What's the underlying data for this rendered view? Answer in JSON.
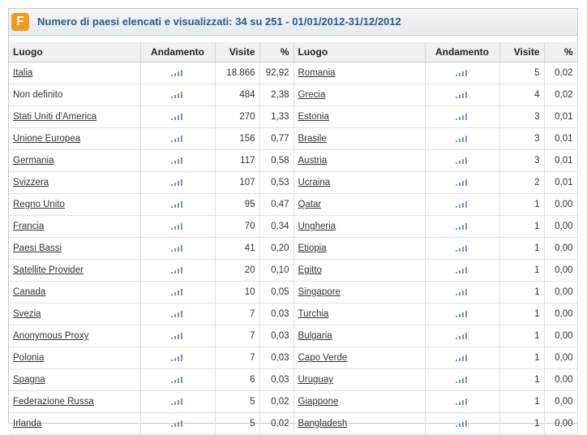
{
  "header": {
    "title": "Numero di paesi elencati e visualizzati: 34 su 251 - 01/01/2012-31/12/2012",
    "logo_letter": "F"
  },
  "columns": {
    "luogo": "Luogo",
    "andamento": "Andamento",
    "visite": "Visite",
    "pct": "%"
  },
  "left": [
    {
      "name": "Italia",
      "visits": "18.866",
      "pct": "92,92",
      "link": true
    },
    {
      "name": "Non definito",
      "visits": "484",
      "pct": "2,38",
      "link": false
    },
    {
      "name": "Stati Uniti d'America",
      "visits": "270",
      "pct": "1,33",
      "link": true
    },
    {
      "name": "Unione Europea",
      "visits": "156",
      "pct": "0,77",
      "link": true
    },
    {
      "name": "Germania",
      "visits": "117",
      "pct": "0,58",
      "link": true
    },
    {
      "name": "Svizzera",
      "visits": "107",
      "pct": "0,53",
      "link": true
    },
    {
      "name": "Regno Unito",
      "visits": "95",
      "pct": "0,47",
      "link": true
    },
    {
      "name": "Francia",
      "visits": "70",
      "pct": "0,34",
      "link": true
    },
    {
      "name": "Paesi Bassi",
      "visits": "41",
      "pct": "0,20",
      "link": true
    },
    {
      "name": "Satellite Provider",
      "visits": "20",
      "pct": "0,10",
      "link": true
    },
    {
      "name": "Canada",
      "visits": "10",
      "pct": "0,05",
      "link": true
    },
    {
      "name": "Svezia",
      "visits": "7",
      "pct": "0,03",
      "link": true
    },
    {
      "name": "Anonymous Proxy",
      "visits": "7",
      "pct": "0,03",
      "link": true
    },
    {
      "name": "Polonia",
      "visits": "7",
      "pct": "0,03",
      "link": true
    },
    {
      "name": "Spagna",
      "visits": "6",
      "pct": "0,03",
      "link": true
    },
    {
      "name": "Federazione Russa",
      "visits": "5",
      "pct": "0,02",
      "link": true
    },
    {
      "name": "Irlanda",
      "visits": "5",
      "pct": "0,02",
      "link": true
    }
  ],
  "right": [
    {
      "name": "Romania",
      "visits": "5",
      "pct": "0,02",
      "link": true
    },
    {
      "name": "Grecia",
      "visits": "4",
      "pct": "0,02",
      "link": true
    },
    {
      "name": "Estonia",
      "visits": "3",
      "pct": "0,01",
      "link": true
    },
    {
      "name": "Brasile",
      "visits": "3",
      "pct": "0,01",
      "link": true
    },
    {
      "name": "Austria",
      "visits": "3",
      "pct": "0,01",
      "link": true
    },
    {
      "name": "Ucraina",
      "visits": "2",
      "pct": "0,01",
      "link": true
    },
    {
      "name": "Qatar",
      "visits": "1",
      "pct": "0,00",
      "link": true
    },
    {
      "name": "Ungheria",
      "visits": "1",
      "pct": "0,00",
      "link": true
    },
    {
      "name": "Etiopia",
      "visits": "1",
      "pct": "0,00",
      "link": true
    },
    {
      "name": "Egitto",
      "visits": "1",
      "pct": "0,00",
      "link": true
    },
    {
      "name": "Singapore",
      "visits": "1",
      "pct": "0,00",
      "link": true
    },
    {
      "name": "Turchia",
      "visits": "1",
      "pct": "0,00",
      "link": true
    },
    {
      "name": "Bulgaria",
      "visits": "1",
      "pct": "0,00",
      "link": true
    },
    {
      "name": "Capo Verde",
      "visits": "1",
      "pct": "0,00",
      "link": true
    },
    {
      "name": "Uruguay",
      "visits": "1",
      "pct": "0,00",
      "link": true
    },
    {
      "name": "Giappone",
      "visits": "1",
      "pct": "0,00",
      "link": true
    },
    {
      "name": "Bangladesh",
      "visits": "1",
      "pct": "0,00",
      "link": true
    }
  ],
  "icons": {
    "trend": "trend-bars-icon"
  },
  "colors": {
    "title": "#2b5a8a",
    "logo": "#f39a1e",
    "bars": "#7f95ad"
  }
}
